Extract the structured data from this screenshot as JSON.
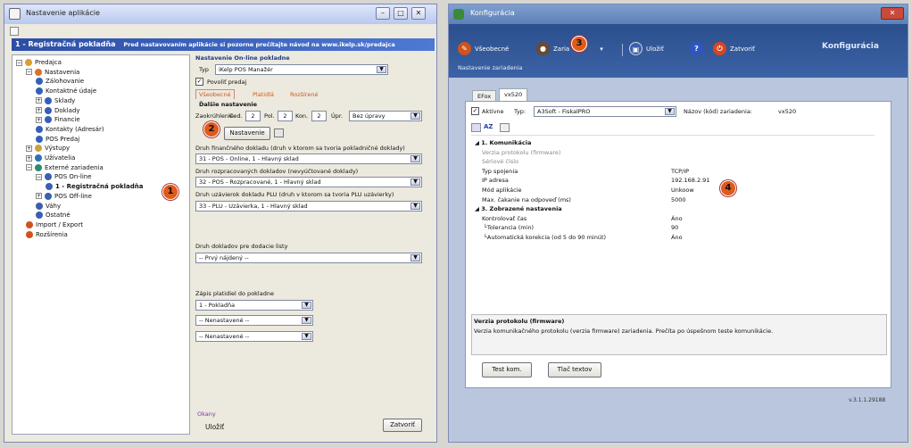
{
  "left_window": {
    "title": "Nastavenie aplikácie",
    "banner_title": "1 - Registračná pokladňa",
    "banner_subtitle": "Pred nastavovaním aplikácie si pozorne prečítajte návod na www.ikelp.sk/predajca",
    "tree": [
      {
        "label": "Predajca",
        "level": 0,
        "exp": "−"
      },
      {
        "label": "Nastavenia",
        "level": 1,
        "exp": "−"
      },
      {
        "label": "Zálohovanie",
        "level": 2,
        "exp": ""
      },
      {
        "label": "Kontaktné údaje",
        "level": 2,
        "exp": ""
      },
      {
        "label": "Sklady",
        "level": 2,
        "exp": "+"
      },
      {
        "label": "Doklady",
        "level": 2,
        "exp": "+"
      },
      {
        "label": "Financie",
        "level": 2,
        "exp": "+"
      },
      {
        "label": "Kontakty (Adresár)",
        "level": 2,
        "exp": ""
      },
      {
        "label": "POS Predaj",
        "level": 2,
        "exp": ""
      },
      {
        "label": "Výstupy",
        "level": 1,
        "exp": "+"
      },
      {
        "label": "Užívatelia",
        "level": 1,
        "exp": "+"
      },
      {
        "label": "Externé zariadenia",
        "level": 1,
        "exp": "−"
      },
      {
        "label": "POS On-line",
        "level": 2,
        "exp": "−"
      },
      {
        "label": "1 - Registračná pokladňa",
        "level": 3,
        "exp": "",
        "selected": true
      },
      {
        "label": "POS Off-line",
        "level": 2,
        "exp": "+"
      },
      {
        "label": "Váhy",
        "level": 2,
        "exp": ""
      },
      {
        "label": "Ostatné",
        "level": 2,
        "exp": ""
      },
      {
        "label": "Import / Export",
        "level": 1,
        "exp": ""
      },
      {
        "label": "Rozšírenia",
        "level": 1,
        "exp": ""
      }
    ],
    "section_title": "Nastavenie On-line pokladne",
    "type_label": "Typ",
    "type_value": "iKelp POS Manažér",
    "allow_sale_label": "Povoliť predaj",
    "tabs": [
      "Všeobecné",
      "Platidlá",
      "Rozšírené"
    ],
    "further_settings": "Ďalšie nastavenie",
    "rounding_label": "Zaokrúhlenie",
    "ced_label": "Ced.",
    "ced_value": "2",
    "pol_label": "Pol.",
    "pol_value": "2",
    "kon_label": "Kon.",
    "kon_value": "2",
    "upr_label": "Úpr.",
    "upr_value": "Bez úpravy",
    "settings_button": "Nastavenie",
    "fin_doc_label": "Druh finančného dokladu (druh v ktorom sa tvoria pokladničné doklady)",
    "fin_doc_value": "31 - POS - Online, 1 - Hlavný sklad",
    "processed_label": "Druh rozpracovaných dokladov (nevyúčtované doklady)",
    "processed_value": "32 - POS - Rozpracované, 1 - Hlavný sklad",
    "plu_label": "Druh uzávierok dokladu PLU (druh v ktorom sa tvoria PLU uzávierky)",
    "plu_value": "33 - PLU - Uzávierka, 1 - Hlavný sklad",
    "delivery_label": "Druh dokladov pre dodacie listy",
    "delivery_value": "-- Prvý nájdený --",
    "payments_label": "Zápis platidiel do pokladne",
    "payments": [
      "1 - Pokladňa",
      "-- Nenastavené --",
      "-- Nenastavené --"
    ],
    "footer_label": "Okany",
    "save_label": "Uložiť",
    "close_label": "Zatvoriť"
  },
  "right_window": {
    "title": "Konfigurácia",
    "heading": "Konfigurácia",
    "subheading": "Nastavenie zariadenia",
    "toolbar": {
      "general": "Všeobecné",
      "device": "Zaria",
      "save": "Uložiť",
      "close": "Zatvoriť"
    },
    "tabs": [
      "EFox",
      "vx520"
    ],
    "active_label": "Aktívne",
    "type_label": "Typ:",
    "type_value": "A3Soft - FiskalPRO",
    "name_label": "Názov (kód) zariadenia:",
    "name_value": "vx520",
    "props": [
      {
        "name": "1. Komunikácia",
        "value": "",
        "kind": "cat"
      },
      {
        "name": "Verzia protokolu (firmware)",
        "value": "",
        "kind": "gray"
      },
      {
        "name": "Sériové číslo",
        "value": "",
        "kind": "gray"
      },
      {
        "name": "Typ spojenia",
        "value": "TCP/IP",
        "kind": "item"
      },
      {
        "name": "IP adresa",
        "value": "192.168.2.91",
        "kind": "item"
      },
      {
        "name": "Mód aplikácie",
        "value": "Unkoow",
        "kind": "item"
      },
      {
        "name": "Max. čakanie na odpoveď (ms)",
        "value": "5000",
        "kind": "item"
      },
      {
        "name": "3. Zobrazené nastavenia",
        "value": "",
        "kind": "cat"
      },
      {
        "name": "Kontrolovať čas",
        "value": "Áno",
        "kind": "item"
      },
      {
        "name": "└Tolerancia (min)",
        "value": "90",
        "kind": "sub"
      },
      {
        "name": "└Automatická korekcia (od 5 do 90 minút)",
        "value": "Áno",
        "kind": "sub"
      }
    ],
    "desc_title": "Verzia protokolu (firmware)",
    "desc_text": "Verzia komunikačného protokolu (verzia firmware) zariadenia. Prečíta po úspešnom teste komunikácie.",
    "test_button": "Test kom.",
    "print_button": "Tlač textov",
    "version": "v.3.1.1.29188"
  },
  "callouts": [
    "1",
    "2",
    "3",
    "4"
  ]
}
